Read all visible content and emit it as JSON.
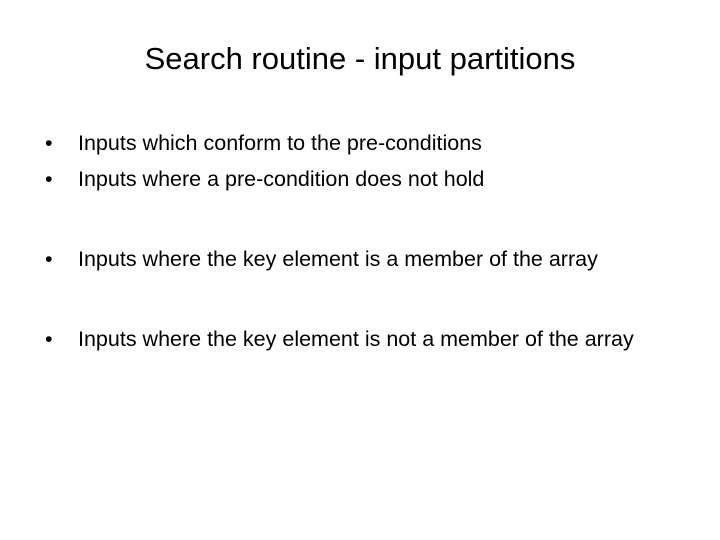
{
  "slide": {
    "title": "Search routine - input partitions",
    "bullet_marker": "•",
    "groups": [
      {
        "bullets": [
          {
            "text": "Inputs which conform to the pre-conditions"
          },
          {
            "text": "Inputs where a pre-condition does not hold"
          }
        ]
      },
      {
        "bullets": [
          {
            "text": "Inputs where the key element is a member of the array"
          }
        ]
      },
      {
        "bullets": [
          {
            "text": "Inputs where the key element is not a member of the array"
          }
        ]
      }
    ],
    "colors": {
      "text": "#000000",
      "background": "#ffffff"
    }
  }
}
